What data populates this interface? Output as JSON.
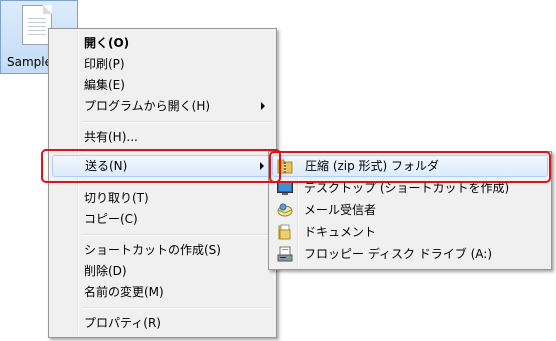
{
  "desktop": {
    "file_name": "Sample"
  },
  "context_menu": {
    "items": [
      {
        "label": "開く(O)"
      },
      {
        "label": "印刷(P)"
      },
      {
        "label": "編集(E)"
      },
      {
        "label": "プログラムから開く(H)"
      },
      {
        "label": "共有(H)..."
      },
      {
        "label": "送る(N)"
      },
      {
        "label": "切り取り(T)"
      },
      {
        "label": "コピー(C)"
      },
      {
        "label": "ショートカットの作成(S)"
      },
      {
        "label": "削除(D)"
      },
      {
        "label": "名前の変更(M)"
      },
      {
        "label": "プロパティ(R)"
      }
    ]
  },
  "send_to_menu": {
    "items": [
      {
        "label": "圧縮 (zip 形式) フォルダ",
        "icon": "zip-folder-icon"
      },
      {
        "label": "デスクトップ (ショートカットを作成)",
        "icon": "desktop-icon"
      },
      {
        "label": "メール受信者",
        "icon": "mail-icon"
      },
      {
        "label": "ドキュメント",
        "icon": "documents-icon"
      },
      {
        "label": "フロッピー ディスク ドライブ (A:)",
        "icon": "floppy-drive-icon"
      }
    ]
  },
  "colors": {
    "highlight_border": "#aecff7",
    "annotation_red": "#d9141b",
    "menu_bg": "#f0f0f0"
  }
}
